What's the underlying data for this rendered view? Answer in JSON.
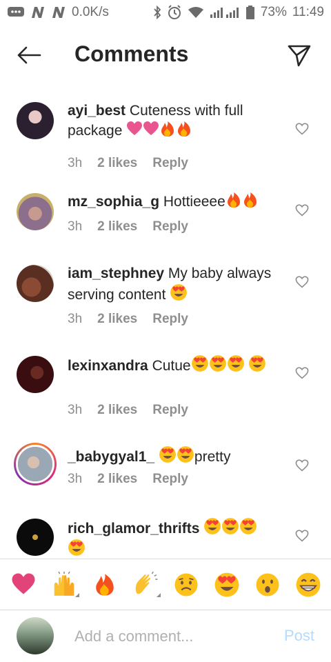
{
  "status_bar": {
    "net_speed": "0.0K/s",
    "battery": "73%",
    "time": "11:49"
  },
  "header": {
    "title": "Comments"
  },
  "comments": [
    {
      "username": "ayi_best",
      "text": "Cuteness with full package",
      "emojis": [
        "pink-heart",
        "pink-heart",
        "fire",
        "fire"
      ],
      "time": "3h",
      "likes": "2 likes",
      "reply": "Reply",
      "avatar_color": "#2a2030"
    },
    {
      "username": "mz_sophia_g",
      "text": "Hottieeee",
      "emojis": [
        "fire",
        "fire"
      ],
      "time": "3h",
      "likes": "2 likes",
      "reply": "Reply",
      "avatar_color": "#8b6f8c"
    },
    {
      "username": "iam_stephney",
      "text": "My baby always serving content",
      "emojis": [
        "heart-eyes"
      ],
      "time": "3h",
      "likes": "2 likes",
      "reply": "Reply",
      "avatar_color": "#5a2f22"
    },
    {
      "username": "lexinxandra",
      "text": "Cutue",
      "emojis": [
        "heart-eyes",
        "heart-eyes",
        "heart-eyes",
        "heart-eyes"
      ],
      "time": "3h",
      "likes": "2 likes",
      "reply": "Reply",
      "avatar_color": "#3a0e10"
    },
    {
      "username": "_babygyal1_",
      "text": "pretty",
      "emojis": [
        "heart-eyes",
        "heart-eyes"
      ],
      "time": "3h",
      "likes": "2 likes",
      "reply": "Reply",
      "avatar_color": "#9aa7b4"
    },
    {
      "username": "rich_glamor_thrifts",
      "text": "",
      "emojis": [
        "heart-eyes",
        "heart-eyes",
        "heart-eyes",
        "heart-eyes"
      ],
      "avatar_color": "#0b0b0b"
    }
  ],
  "quick_reactions": [
    "red-heart",
    "raised-hands",
    "fire",
    "clapping-hands",
    "crying-face",
    "heart-eyes",
    "surprised-face",
    "grinning-face"
  ],
  "add_comment": {
    "placeholder": "Add a comment...",
    "post_label": "Post"
  }
}
